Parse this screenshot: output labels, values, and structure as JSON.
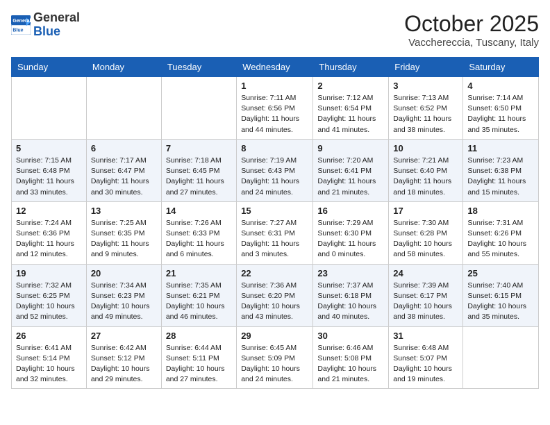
{
  "header": {
    "logo_general": "General",
    "logo_blue": "Blue",
    "month_title": "October 2025",
    "location": "Vacchereccia, Tuscany, Italy"
  },
  "days_of_week": [
    "Sunday",
    "Monday",
    "Tuesday",
    "Wednesday",
    "Thursday",
    "Friday",
    "Saturday"
  ],
  "weeks": [
    {
      "days": [
        {
          "number": "",
          "info": ""
        },
        {
          "number": "",
          "info": ""
        },
        {
          "number": "",
          "info": ""
        },
        {
          "number": "1",
          "info": "Sunrise: 7:11 AM\nSunset: 6:56 PM\nDaylight: 11 hours and 44 minutes."
        },
        {
          "number": "2",
          "info": "Sunrise: 7:12 AM\nSunset: 6:54 PM\nDaylight: 11 hours and 41 minutes."
        },
        {
          "number": "3",
          "info": "Sunrise: 7:13 AM\nSunset: 6:52 PM\nDaylight: 11 hours and 38 minutes."
        },
        {
          "number": "4",
          "info": "Sunrise: 7:14 AM\nSunset: 6:50 PM\nDaylight: 11 hours and 35 minutes."
        }
      ]
    },
    {
      "days": [
        {
          "number": "5",
          "info": "Sunrise: 7:15 AM\nSunset: 6:48 PM\nDaylight: 11 hours and 33 minutes."
        },
        {
          "number": "6",
          "info": "Sunrise: 7:17 AM\nSunset: 6:47 PM\nDaylight: 11 hours and 30 minutes."
        },
        {
          "number": "7",
          "info": "Sunrise: 7:18 AM\nSunset: 6:45 PM\nDaylight: 11 hours and 27 minutes."
        },
        {
          "number": "8",
          "info": "Sunrise: 7:19 AM\nSunset: 6:43 PM\nDaylight: 11 hours and 24 minutes."
        },
        {
          "number": "9",
          "info": "Sunrise: 7:20 AM\nSunset: 6:41 PM\nDaylight: 11 hours and 21 minutes."
        },
        {
          "number": "10",
          "info": "Sunrise: 7:21 AM\nSunset: 6:40 PM\nDaylight: 11 hours and 18 minutes."
        },
        {
          "number": "11",
          "info": "Sunrise: 7:23 AM\nSunset: 6:38 PM\nDaylight: 11 hours and 15 minutes."
        }
      ]
    },
    {
      "days": [
        {
          "number": "12",
          "info": "Sunrise: 7:24 AM\nSunset: 6:36 PM\nDaylight: 11 hours and 12 minutes."
        },
        {
          "number": "13",
          "info": "Sunrise: 7:25 AM\nSunset: 6:35 PM\nDaylight: 11 hours and 9 minutes."
        },
        {
          "number": "14",
          "info": "Sunrise: 7:26 AM\nSunset: 6:33 PM\nDaylight: 11 hours and 6 minutes."
        },
        {
          "number": "15",
          "info": "Sunrise: 7:27 AM\nSunset: 6:31 PM\nDaylight: 11 hours and 3 minutes."
        },
        {
          "number": "16",
          "info": "Sunrise: 7:29 AM\nSunset: 6:30 PM\nDaylight: 11 hours and 0 minutes."
        },
        {
          "number": "17",
          "info": "Sunrise: 7:30 AM\nSunset: 6:28 PM\nDaylight: 10 hours and 58 minutes."
        },
        {
          "number": "18",
          "info": "Sunrise: 7:31 AM\nSunset: 6:26 PM\nDaylight: 10 hours and 55 minutes."
        }
      ]
    },
    {
      "days": [
        {
          "number": "19",
          "info": "Sunrise: 7:32 AM\nSunset: 6:25 PM\nDaylight: 10 hours and 52 minutes."
        },
        {
          "number": "20",
          "info": "Sunrise: 7:34 AM\nSunset: 6:23 PM\nDaylight: 10 hours and 49 minutes."
        },
        {
          "number": "21",
          "info": "Sunrise: 7:35 AM\nSunset: 6:21 PM\nDaylight: 10 hours and 46 minutes."
        },
        {
          "number": "22",
          "info": "Sunrise: 7:36 AM\nSunset: 6:20 PM\nDaylight: 10 hours and 43 minutes."
        },
        {
          "number": "23",
          "info": "Sunrise: 7:37 AM\nSunset: 6:18 PM\nDaylight: 10 hours and 40 minutes."
        },
        {
          "number": "24",
          "info": "Sunrise: 7:39 AM\nSunset: 6:17 PM\nDaylight: 10 hours and 38 minutes."
        },
        {
          "number": "25",
          "info": "Sunrise: 7:40 AM\nSunset: 6:15 PM\nDaylight: 10 hours and 35 minutes."
        }
      ]
    },
    {
      "days": [
        {
          "number": "26",
          "info": "Sunrise: 6:41 AM\nSunset: 5:14 PM\nDaylight: 10 hours and 32 minutes."
        },
        {
          "number": "27",
          "info": "Sunrise: 6:42 AM\nSunset: 5:12 PM\nDaylight: 10 hours and 29 minutes."
        },
        {
          "number": "28",
          "info": "Sunrise: 6:44 AM\nSunset: 5:11 PM\nDaylight: 10 hours and 27 minutes."
        },
        {
          "number": "29",
          "info": "Sunrise: 6:45 AM\nSunset: 5:09 PM\nDaylight: 10 hours and 24 minutes."
        },
        {
          "number": "30",
          "info": "Sunrise: 6:46 AM\nSunset: 5:08 PM\nDaylight: 10 hours and 21 minutes."
        },
        {
          "number": "31",
          "info": "Sunrise: 6:48 AM\nSunset: 5:07 PM\nDaylight: 10 hours and 19 minutes."
        },
        {
          "number": "",
          "info": ""
        }
      ]
    }
  ]
}
